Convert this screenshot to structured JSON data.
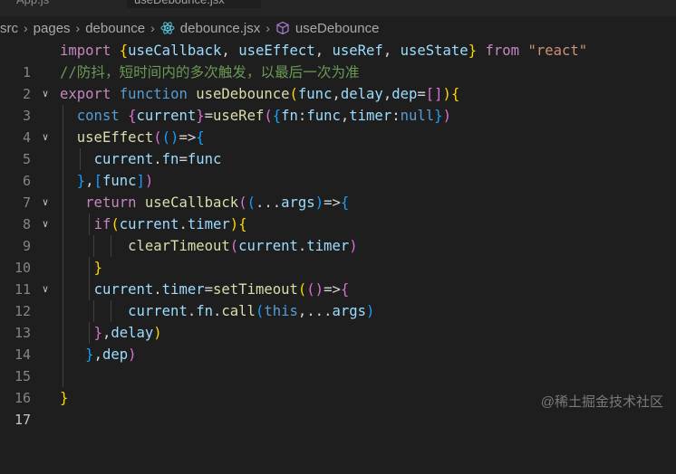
{
  "tabs": [
    "App.js",
    "useDebounce.jsx"
  ],
  "breadcrumb": {
    "items": [
      "src",
      "pages",
      "debounce",
      "debounce.jsx",
      "useDebounce"
    ],
    "file_icon": "react-icon",
    "symbol_icon": "cube-icon"
  },
  "editor": {
    "current_line": 17,
    "line_numbers": [
      "1",
      "2",
      "3",
      "4",
      "5",
      "6",
      "7",
      "8",
      "9",
      "10",
      "11",
      "12",
      "13",
      "14",
      "15",
      "16",
      "17"
    ],
    "lines": [
      "import {useCallback, useEffect, useRef, useState} from \"react\"",
      "//防抖，短时间内的多次触发，以最后一次为准",
      "export function useDebounce(func,delay,dep=[]){",
      "  const {current}=useRef({fn:func,timer:null})",
      "  useEffect(()=>{",
      "    current.fn=func",
      "  },[func])",
      "   return useCallback((...args)=>{",
      "    if(current.timer){",
      "        clearTimeout(current.timer)",
      "    }",
      "    current.timer=setTimeout(()=>{",
      "        current.fn.call(this,...args)",
      "    },delay)",
      "   },dep)",
      "",
      "}"
    ],
    "tokens": {
      "import": "import",
      "from": "from",
      "react": "\"react\"",
      "useCallback": "useCallback",
      "useEffect": "useEffect",
      "useRef": "useRef",
      "useState": "useState",
      "comment": "//防抖，短时间内的多次触发，以最后一次为准",
      "export": "export",
      "function": "function",
      "useDebounce": "useDebounce",
      "func": "func",
      "delay": "delay",
      "dep": "dep",
      "const": "const",
      "current": "current",
      "fn": "fn",
      "timer": "timer",
      "null": "null",
      "return": "return",
      "args": "args",
      "if": "if",
      "clearTimeout": "clearTimeout",
      "setTimeout": "setTimeout",
      "call": "call",
      "this": "this"
    }
  },
  "watermark": "@稀土掘金技术社区",
  "colors": {
    "background": "#1e1e1e",
    "keyword": "#569cd6",
    "control": "#c586c0",
    "function": "#dcdcaa",
    "variable": "#9cdcfe",
    "string": "#ce9178",
    "comment": "#6a9955",
    "bracket_gold": "#ffd700",
    "bracket_purple": "#da70d6",
    "bracket_blue": "#179fff"
  }
}
